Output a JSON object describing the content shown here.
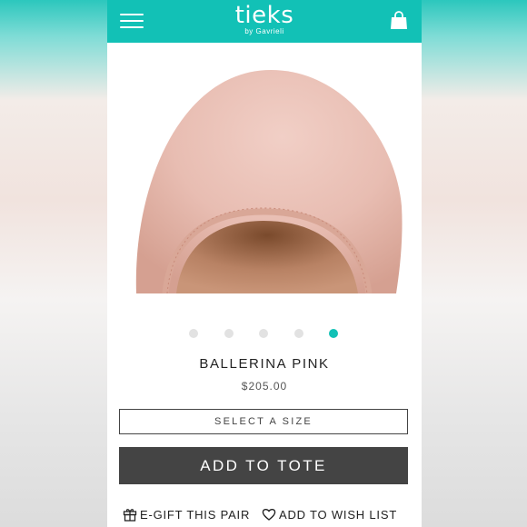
{
  "header": {
    "brand": "tieks",
    "brand_sub": "by Gavrieli",
    "accent_color": "#12c1b6",
    "icons": [
      "menu-icon",
      "shopping-bag-icon"
    ]
  },
  "product": {
    "image": "ballerina-pink-flat-toe-closeup",
    "name": "BALLERINA PINK",
    "price": "$205.00",
    "carousel": {
      "total": 5,
      "active": 5
    }
  },
  "purchase": {
    "size_label": "SELECT A SIZE",
    "add_label": "ADD TO TOTE"
  },
  "actions": {
    "gift_label": "E-GIFT THIS PAIR",
    "wishlist_label": "ADD TO WISH LIST",
    "icons": [
      "gift-icon",
      "heart-icon"
    ]
  }
}
